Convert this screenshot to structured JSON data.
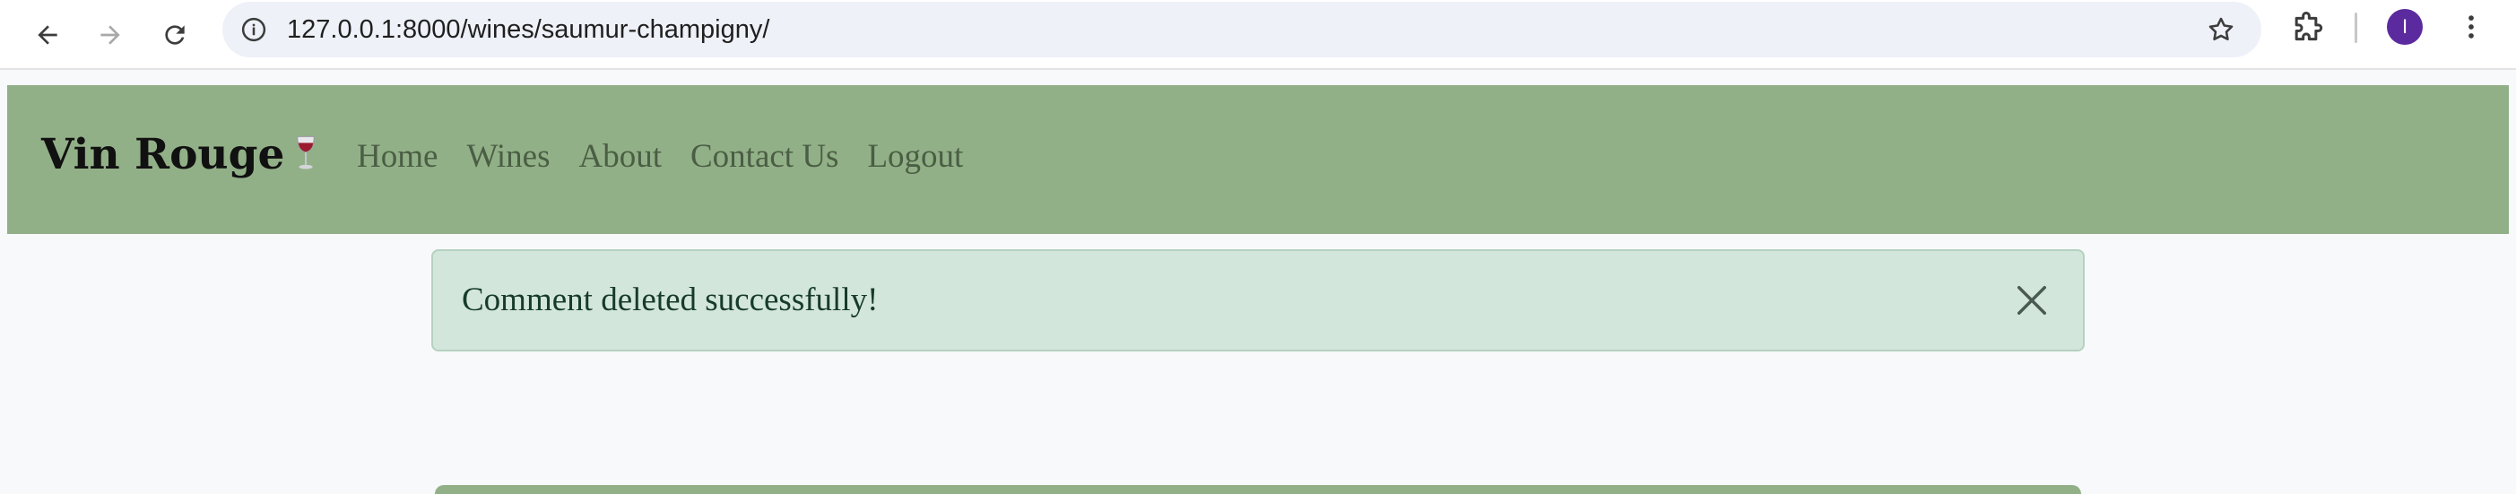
{
  "browser": {
    "url": "127.0.0.1:8000/wines/saumur-champigny/",
    "profile_initial": "I",
    "colors": {
      "profile": "#5b2a9e",
      "url_bar": "#eef1f8"
    }
  },
  "site": {
    "brand": "Vin Rouge",
    "brand_icon": "wine-glass-icon",
    "nav": {
      "home": "Home",
      "wines": "Wines",
      "about": "About",
      "contact": "Contact Us",
      "logout": "Logout"
    },
    "colors": {
      "navbar": "#92b087",
      "background": "#f8f9fa"
    }
  },
  "alert": {
    "message": "Comment deleted successfully!",
    "close_icon": "close-icon",
    "colors": {
      "background": "#d3e6dc",
      "text": "#173b2a"
    }
  }
}
